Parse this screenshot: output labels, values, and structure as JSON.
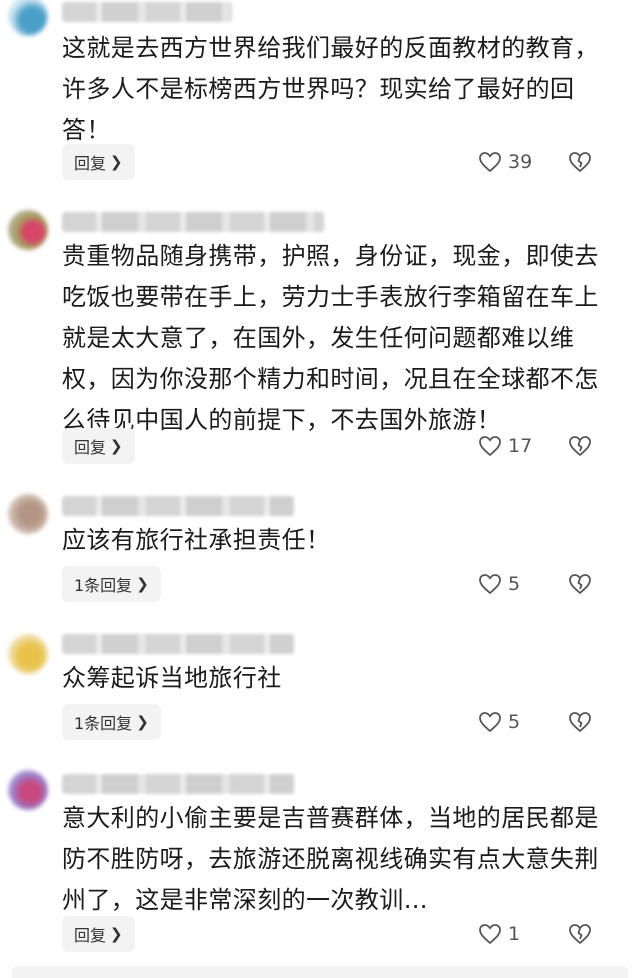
{
  "comments": [
    {
      "text": "这就是去西方世界给我们最好的反面教材的教育，许多人不是标榜西方世界吗？现实给了最好的回答！",
      "reply_label": "回复",
      "likes": "39"
    },
    {
      "text": "贵重物品随身携带，护照，身份证，现金，即使去吃饭也要带在手上，劳力士手表放行李箱留在车上就是太大意了，在国外，发生任何问题都难以维权，因为你没那个精力和时间，况且在全球都不怎么待见中国人的前提下，不去国外旅游！",
      "reply_label": "回复",
      "likes": "17"
    },
    {
      "text": "应该有旅行社承担责任！",
      "reply_label": "1条回复",
      "likes": "5"
    },
    {
      "text": "众筹起诉当地旅行社",
      "reply_label": "1条回复",
      "likes": "5"
    },
    {
      "text": "意大利的小偷主要是吉普赛群体，当地的居民都是防不胜防呀，去旅游还脱离视线确实有点大意失荆州了，这是非常深刻的一次教训…",
      "reply_label": "回复",
      "likes": "1"
    }
  ],
  "icons": {
    "reply_chevron": "chevron-right-icon",
    "like": "heart-outline-icon",
    "dislike": "broken-heart-icon"
  },
  "colors": {
    "reply_bg": "#f3f3f3",
    "icon": "#555555"
  }
}
